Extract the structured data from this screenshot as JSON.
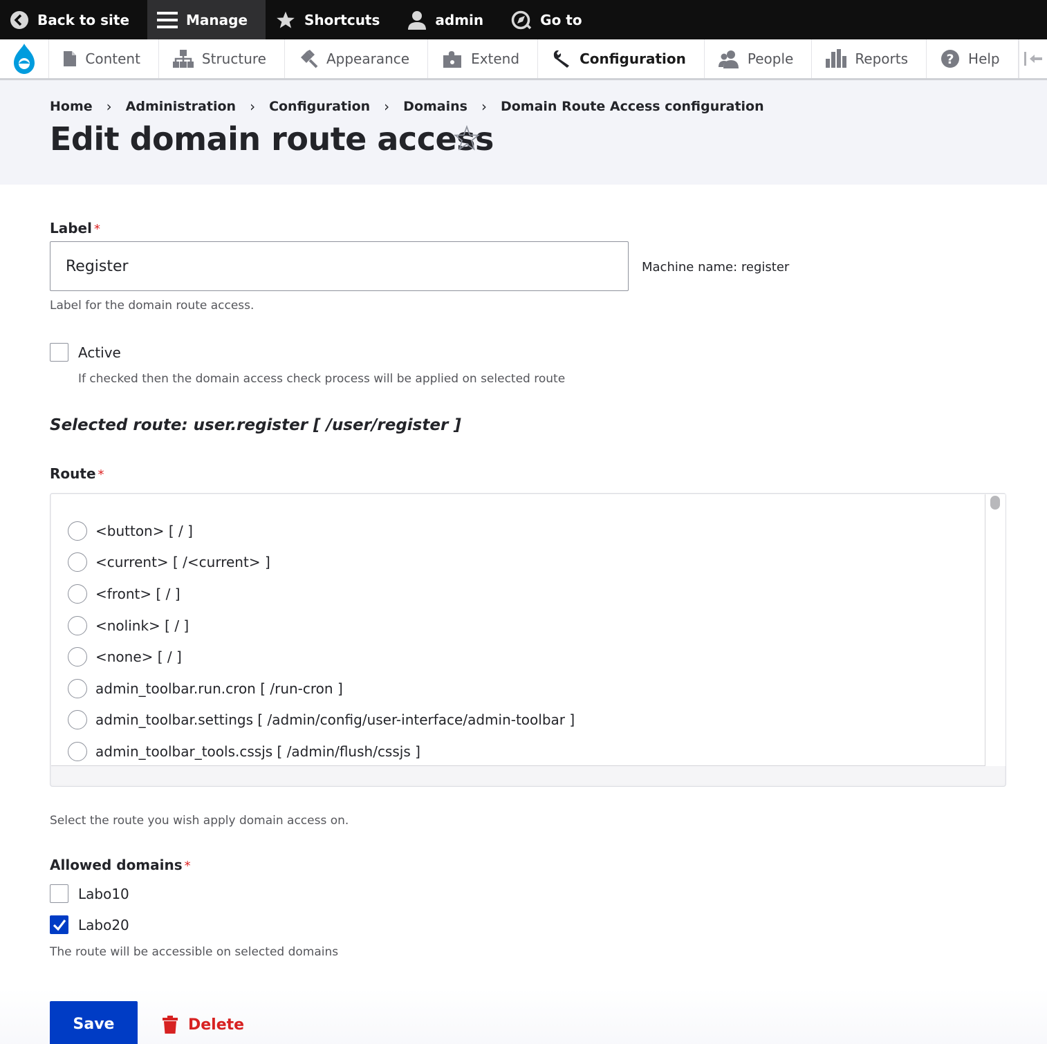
{
  "toolbar": {
    "back_to_site": "Back to site",
    "manage": "Manage",
    "shortcuts": "Shortcuts",
    "user": "admin",
    "go_to": "Go to"
  },
  "tray": {
    "items": [
      {
        "label": "Content",
        "icon": "file-icon"
      },
      {
        "label": "Structure",
        "icon": "sitemap-icon"
      },
      {
        "label": "Appearance",
        "icon": "paintbrush-icon"
      },
      {
        "label": "Extend",
        "icon": "puzzle-icon"
      },
      {
        "label": "Configuration",
        "icon": "wrench-icon"
      },
      {
        "label": "People",
        "icon": "people-icon"
      },
      {
        "label": "Reports",
        "icon": "bar-chart-icon"
      },
      {
        "label": "Help",
        "icon": "help-icon"
      }
    ],
    "active": "Configuration"
  },
  "breadcrumb": [
    "Home",
    "Administration",
    "Configuration",
    "Domains",
    "Domain Route Access configuration"
  ],
  "page_title": "Edit domain route access",
  "form": {
    "label_field": {
      "label": "Label",
      "required_mark": "*",
      "value": "Register",
      "machine_name": "Machine name: register",
      "description": "Label for the domain route access."
    },
    "active": {
      "label": "Active",
      "checked": false,
      "description": "If checked then the domain access check process will be applied on selected route"
    },
    "selected_route": "Selected route: user.register [ /user/register ]",
    "route": {
      "label": "Route",
      "required_mark": "*",
      "options": [
        "<button> [ / ]",
        "<current> [ /<current> ]",
        "<front> [ / ]",
        "<nolink> [ / ]",
        "<none> [ / ]",
        "admin_toolbar.run.cron [ /run-cron ]",
        "admin_toolbar.settings [ /admin/config/user-interface/admin-toolbar ]",
        "admin_toolbar_tools.cssjs [ /admin/flush/cssjs ]"
      ],
      "description": "Select the route you wish apply domain access on."
    },
    "allowed_domains": {
      "label": "Allowed domains",
      "required_mark": "*",
      "options": [
        {
          "label": "Labo10",
          "checked": false
        },
        {
          "label": "Labo20",
          "checked": true
        }
      ],
      "description": "The route will be accessible on selected domains"
    }
  },
  "actions": {
    "save": "Save",
    "delete": "Delete"
  },
  "colors": {
    "primary": "#003cc5",
    "danger": "#d72222",
    "required": "#dc2323",
    "toolbar_bg": "#0f0f0f"
  }
}
